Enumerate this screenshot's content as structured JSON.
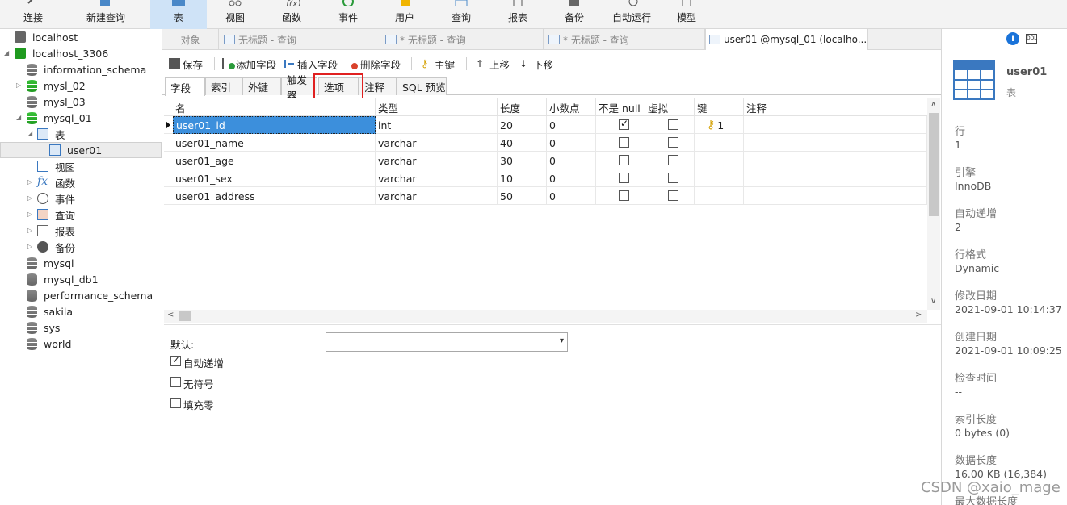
{
  "toolbar": {
    "items": [
      {
        "label": "连接"
      },
      {
        "label": "新建查询"
      },
      {
        "label": "表"
      },
      {
        "label": "视图"
      },
      {
        "label": "函数"
      },
      {
        "label": "事件"
      },
      {
        "label": "用户"
      },
      {
        "label": "查询"
      },
      {
        "label": "报表"
      },
      {
        "label": "备份"
      },
      {
        "label": "自动运行"
      },
      {
        "label": "模型"
      }
    ]
  },
  "tree": {
    "items": [
      {
        "label": "localhost"
      },
      {
        "label": "localhost_3306"
      },
      {
        "label": "information_schema"
      },
      {
        "label": "mysl_02"
      },
      {
        "label": "mysl_03"
      },
      {
        "label": "mysql_01"
      },
      {
        "label": "表"
      },
      {
        "label": "user01"
      },
      {
        "label": "视图"
      },
      {
        "label": "函数"
      },
      {
        "label": "事件"
      },
      {
        "label": "查询"
      },
      {
        "label": "报表"
      },
      {
        "label": "备份"
      },
      {
        "label": "mysql"
      },
      {
        "label": "mysql_db1"
      },
      {
        "label": "performance_schema"
      },
      {
        "label": "sakila"
      },
      {
        "label": "sys"
      },
      {
        "label": "world"
      }
    ]
  },
  "doc_tabs": [
    {
      "label": "对象"
    },
    {
      "label": "无标题 - 查询"
    },
    {
      "label": "* 无标题 - 查询"
    },
    {
      "label": "* 无标题 - 查询"
    },
    {
      "label": "user01 @mysql_01 (localho..."
    }
  ],
  "design_bar": {
    "save": "保存",
    "add_field": "添加字段",
    "insert_field": "插入字段",
    "delete_field": "删除字段",
    "primary_key": "主键",
    "move_up": "上移",
    "move_down": "下移"
  },
  "inner_tabs": [
    {
      "label": "字段"
    },
    {
      "label": "索引"
    },
    {
      "label": "外键"
    },
    {
      "label": "触发器"
    },
    {
      "label": "选项"
    },
    {
      "label": "注释"
    },
    {
      "label": "SQL 预览"
    }
  ],
  "grid": {
    "headers": {
      "name": "名",
      "type": "类型",
      "length": "长度",
      "decimals": "小数点",
      "not_null": "不是 null",
      "virtual": "虚拟",
      "key": "键",
      "comment": "注释"
    },
    "rows": [
      {
        "name": "user01_id",
        "type": "int",
        "length": "20",
        "decimals": "0",
        "not_null": true,
        "virtual": false,
        "key": "1"
      },
      {
        "name": "user01_name",
        "type": "varchar",
        "length": "40",
        "decimals": "0",
        "not_null": false,
        "virtual": false,
        "key": ""
      },
      {
        "name": "user01_age",
        "type": "varchar",
        "length": "30",
        "decimals": "0",
        "not_null": false,
        "virtual": false,
        "key": ""
      },
      {
        "name": "user01_sex",
        "type": "varchar",
        "length": "10",
        "decimals": "0",
        "not_null": false,
        "virtual": false,
        "key": ""
      },
      {
        "name": "user01_address",
        "type": "varchar",
        "length": "50",
        "decimals": "0",
        "not_null": false,
        "virtual": false,
        "key": ""
      }
    ]
  },
  "options": {
    "default_label": "默认:",
    "auto_increment": "自动递增",
    "unsigned": "无符号",
    "zerofill": "填充零",
    "auto_increment_checked": true,
    "unsigned_checked": false,
    "zerofill_checked": false
  },
  "info": {
    "title": "user01",
    "subtitle": "表",
    "fields": [
      {
        "label": "行",
        "value": "1"
      },
      {
        "label": "引擎",
        "value": "InnoDB"
      },
      {
        "label": "自动递增",
        "value": "2"
      },
      {
        "label": "行格式",
        "value": "Dynamic"
      },
      {
        "label": "修改日期",
        "value": "2021-09-01 10:14:37"
      },
      {
        "label": "创建日期",
        "value": "2021-09-01 10:09:25"
      },
      {
        "label": "检查时间",
        "value": "--"
      },
      {
        "label": "索引长度",
        "value": "0 bytes (0)"
      },
      {
        "label": "数据长度",
        "value": "16.00 KB (16,384)"
      },
      {
        "label": "最大数据长度",
        "value": ""
      }
    ]
  },
  "watermark": "CSDN @xaio_mage",
  "colors": {
    "accent": "#3c8fdc",
    "highlight": "#e02020",
    "db_active": "#1f9a1f"
  }
}
